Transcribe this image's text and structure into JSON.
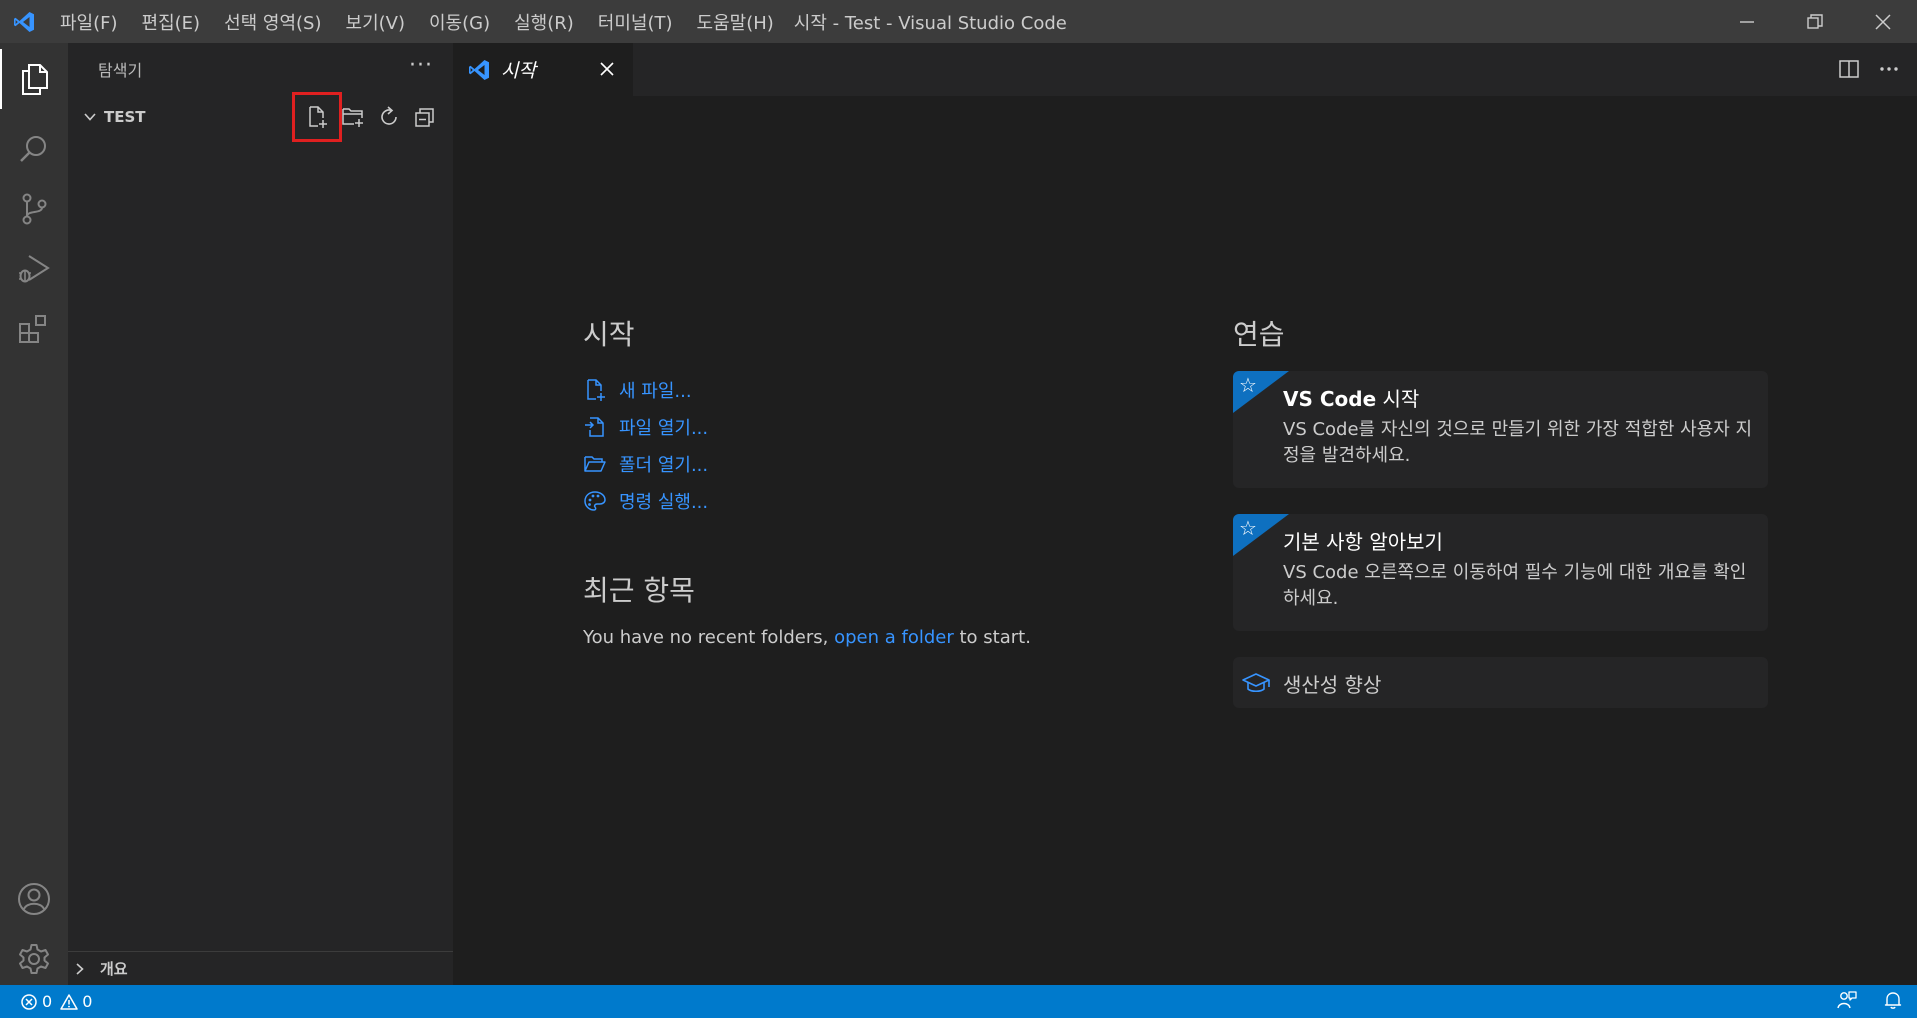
{
  "window": {
    "title": "시작 - Test - Visual Studio Code"
  },
  "menu": {
    "items": [
      "파일(F)",
      "편집(E)",
      "선택 영역(S)",
      "보기(V)",
      "이동(G)",
      "실행(R)",
      "터미널(T)",
      "도움말(H)"
    ]
  },
  "sidebar": {
    "header": "탐색기",
    "more": "···",
    "folder": "TEST",
    "outline": "개요"
  },
  "tab": {
    "label": "시작"
  },
  "welcome": {
    "start_heading": "시작",
    "links": [
      "새 파일...",
      "파일 열기...",
      "폴더 열기...",
      "명령 실행..."
    ],
    "recent_heading": "최근 항목",
    "recent_prefix": "You have no recent folders, ",
    "recent_link": "open a folder",
    "recent_suffix": " to start.",
    "walk_heading": "연습",
    "cards": [
      {
        "title_bold": "VS Code",
        "title_rest": " 시작",
        "desc": "VS Code를 자신의 것으로 만들기 위한 가장 적합한 사용자 지정을 발견하세요."
      },
      {
        "title": "기본 사항 알아보기",
        "desc": "VS Code 오른쪽으로 이동하여 필수 기능에 대한 개요를 확인하세요."
      },
      {
        "title": "생산성 향상"
      }
    ]
  },
  "status": {
    "errors": "0",
    "warnings": "0"
  },
  "colors": {
    "accent": "#007acc",
    "link": "#3794ff",
    "highlight": "#e02020"
  }
}
